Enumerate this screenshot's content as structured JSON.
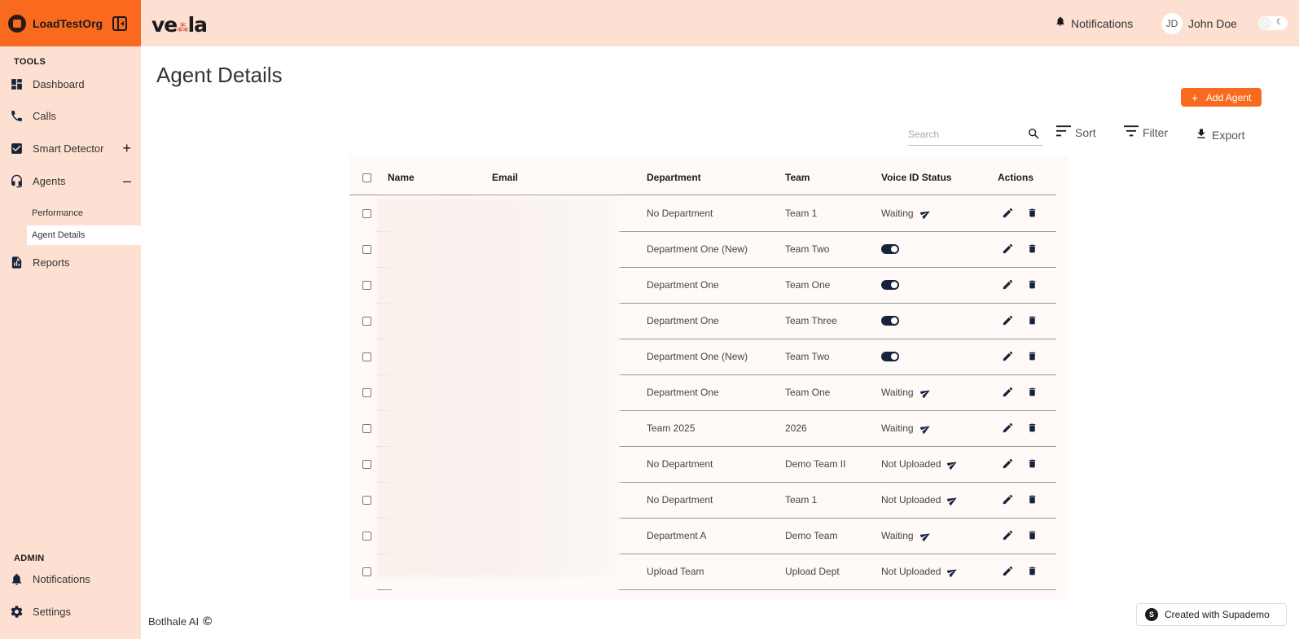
{
  "sidebar": {
    "org_name": "LoadTestOrg",
    "tools_label": "TOOLS",
    "admin_label": "ADMIN",
    "items": [
      {
        "label": "Dashboard",
        "icon": "dashboard-icon"
      },
      {
        "label": "Calls",
        "icon": "phone-icon"
      },
      {
        "label": "Smart Detector",
        "icon": "checkbox-icon",
        "extra": "+"
      },
      {
        "label": "Agents",
        "icon": "headset-icon",
        "extra": "–"
      },
      {
        "label": "Reports",
        "icon": "report-icon"
      }
    ],
    "sub_items": [
      {
        "label": "Performance"
      },
      {
        "label": "Agent Details",
        "active": true
      }
    ],
    "admin_items": [
      {
        "label": "Notifications",
        "icon": "bell-icon"
      },
      {
        "label": "Settings",
        "icon": "gear-icon"
      }
    ]
  },
  "header": {
    "brand": "ve la",
    "notifications_label": "Notifications",
    "user_initials": "JD",
    "user_name": "John Doe"
  },
  "main": {
    "title": "Agent Details",
    "add_button": "Add Agent",
    "search_placeholder": "Search",
    "sort_label": "Sort",
    "filter_label": "Filter",
    "export_label": "Export"
  },
  "table": {
    "columns": [
      "Name",
      "Email",
      "Department",
      "Team",
      "Voice ID Status",
      "Actions"
    ],
    "rows": [
      {
        "department": "No Department",
        "team": "Team 1",
        "status": "Waiting",
        "status_type": "send"
      },
      {
        "department": "Department One (New)",
        "team": "Team Two",
        "status": "",
        "status_type": "toggle"
      },
      {
        "department": "Department One",
        "team": "Team One",
        "status": "",
        "status_type": "toggle"
      },
      {
        "department": "Department One",
        "team": "Team Three",
        "status": "",
        "status_type": "toggle"
      },
      {
        "department": "Department One (New)",
        "team": "Team Two",
        "status": "",
        "status_type": "toggle"
      },
      {
        "department": "Department One",
        "team": "Team One",
        "status": "Waiting",
        "status_type": "send"
      },
      {
        "department": "Team 2025",
        "team": "2026",
        "status": "Waiting",
        "status_type": "send"
      },
      {
        "department": "No Department",
        "team": "Demo Team II",
        "status": "Not Uploaded",
        "status_type": "send"
      },
      {
        "department": "No Department",
        "team": "Team 1",
        "status": "Not Uploaded",
        "status_type": "send"
      },
      {
        "department": "Department A",
        "team": "Demo Team",
        "status": "Waiting",
        "status_type": "send"
      },
      {
        "department": "Upload Team",
        "team": "Upload Dept",
        "status": "Not Uploaded",
        "status_type": "send"
      }
    ]
  },
  "footer": {
    "company": "Botlhale AI",
    "supademo": "Created with Supademo"
  },
  "colors": {
    "accent": "#f96a1f",
    "sidebar_bg": "#fde0d2",
    "icon_dark": "#16233a"
  }
}
